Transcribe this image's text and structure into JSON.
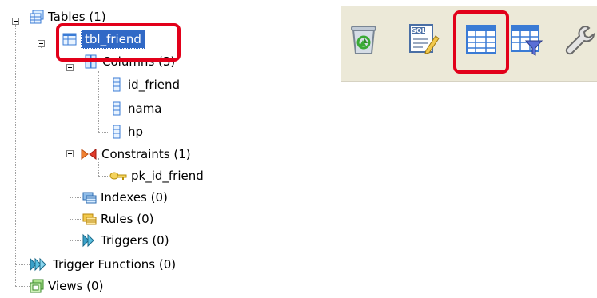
{
  "tree": {
    "tables": "Tables (1)",
    "table": "tbl_friend",
    "columns": "Columns (3)",
    "column_items": [
      "id_friend",
      "nama",
      "hp"
    ],
    "constraints": "Constraints (1)",
    "primary_key": "pk_id_friend",
    "indexes": "Indexes (0)",
    "rules": "Rules (0)",
    "triggers": "Triggers (0)",
    "trigger_functions": "Trigger Functions (0)",
    "views": "Views (0)"
  },
  "toolbar": {
    "icons": [
      "recycle-bin-icon",
      "sql-editor-icon",
      "view-data-icon",
      "filter-data-icon",
      "wrench-icon"
    ],
    "sql_text": "SQL"
  },
  "colors": {
    "selection": "#3169c6",
    "callout": "#e2001a",
    "toolbar_bg": "#ece9d8"
  }
}
